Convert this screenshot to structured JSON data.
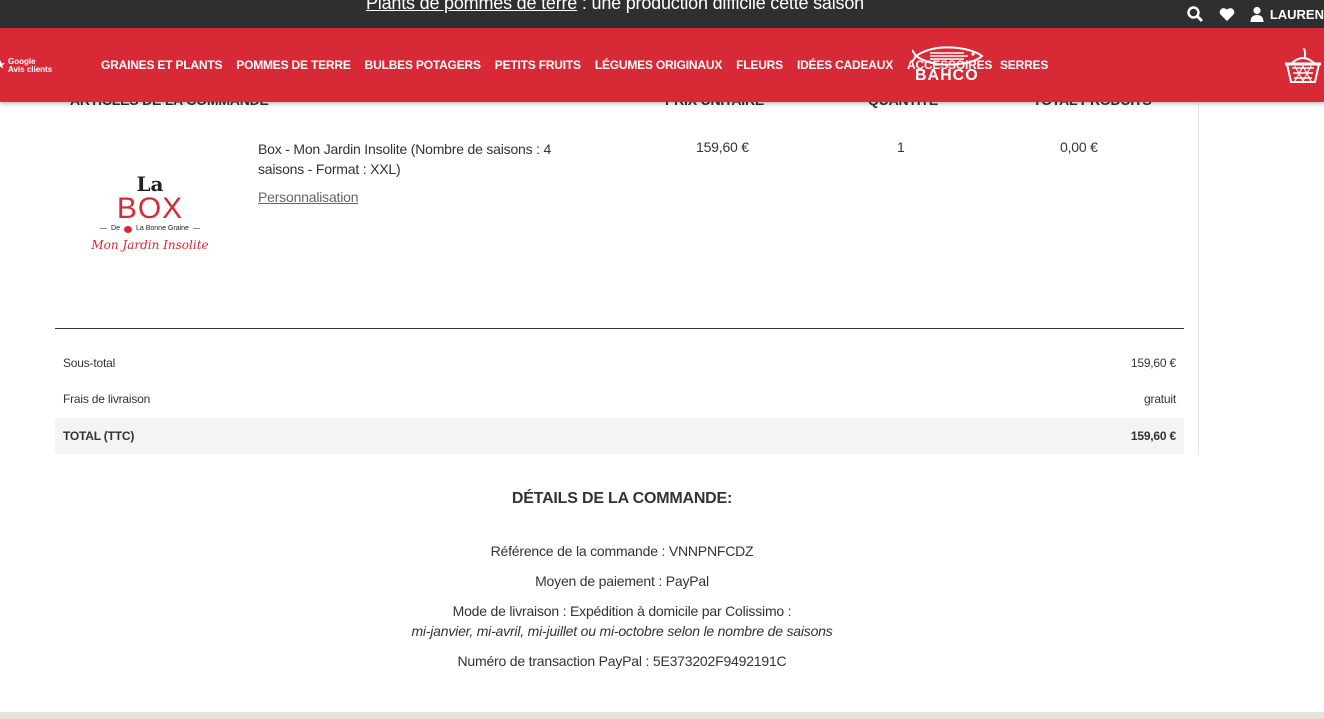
{
  "topbar": {
    "promo_link": "Plants de pommes de terre",
    "promo_rest": " : une production difficile cette saison",
    "user_name": "LAUREN"
  },
  "nav": {
    "google_line1": "Google",
    "google_line2": "Avis clients",
    "items": [
      "GRAINES ET PLANTS",
      "POMMES DE TERRE",
      "BULBES POTAGERS",
      "PETITS FRUITS",
      "LÉGUMES ORIGINAUX",
      "FLEURS",
      "IDÉES CADEAUX",
      "ACCESSOIRES"
    ],
    "brand": "BAHCO",
    "serres": "SERRES"
  },
  "table": {
    "col_articles": "ARTICLES DE LA COMMANDE",
    "col_price": "PRIX UNITAIRE",
    "col_qty": "QUANTITÉ",
    "col_total": "TOTAL PRODUITS"
  },
  "item": {
    "logo_la": "La",
    "logo_box": "BOX",
    "logo_small_de": "De",
    "logo_small_brand": "La Bonne Graine",
    "logo_script": "Mon Jardin Insolite",
    "description": "Box - Mon Jardin Insolite (Nombre de saisons : 4 saisons - Format : XXL)",
    "link": "Personnalisation",
    "unit_price": "159,60 €",
    "quantity": "1",
    "total": "0,00 €"
  },
  "summary": {
    "subtotal_label": "Sous-total",
    "subtotal_value": "159,60 €",
    "shipping_label": "Frais de livraison",
    "shipping_value": "gratuit",
    "total_label": "TOTAL (TTC)",
    "total_value": "159,60 €"
  },
  "details": {
    "title": "DÉTAILS DE LA COMMANDE:",
    "reference": "Référence de la commande : VNNPNFCDZ",
    "payment": "Moyen de paiement : PayPal",
    "delivery": "Mode de livraison : Expédition à domicile par Colissimo :",
    "delivery_note": "mi-janvier, mi-avril, mi-juillet ou mi-octobre selon le nombre de saisons",
    "transaction": "Numéro de transaction PayPal : 5E373202F9492191C"
  },
  "colors": {
    "brand_red": "#d82a36",
    "topbar": "#2f2f2f"
  }
}
